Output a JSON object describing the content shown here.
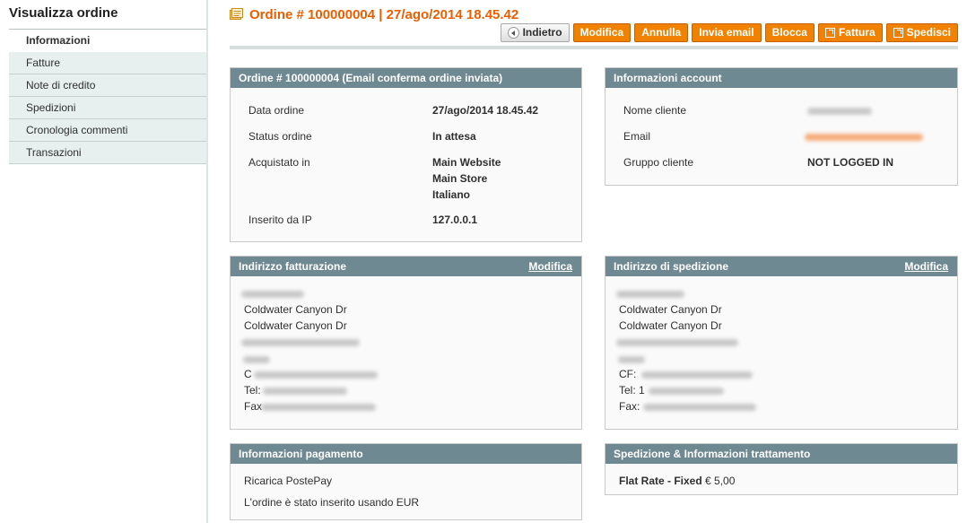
{
  "sidebar": {
    "title": "Visualizza ordine",
    "items": [
      {
        "label": "Informazioni",
        "active": true
      },
      {
        "label": "Fatture",
        "active": false
      },
      {
        "label": "Note di credito",
        "active": false
      },
      {
        "label": "Spedizioni",
        "active": false
      },
      {
        "label": "Cronologia commenti",
        "active": false
      },
      {
        "label": "Transazioni",
        "active": false
      }
    ]
  },
  "header": {
    "icon": "order-document-icon",
    "title": "Ordine # 100000004 | 27/ago/2014 18.45.42",
    "buttons": {
      "back": "Indietro",
      "edit": "Modifica",
      "cancel": "Annulla",
      "send_email": "Invia email",
      "hold": "Blocca",
      "invoice": "Fattura",
      "ship": "Spedisci"
    }
  },
  "order_info": {
    "heading": "Ordine # 100000004 (Email conferma ordine inviata)",
    "order_date_label": "Data ordine",
    "order_date": "27/ago/2014 18.45.42",
    "status_label": "Status ordine",
    "status": "In attesa",
    "purchased_from_label": "Acquistato in",
    "purchased_from": [
      "Main Website",
      "Main Store",
      "Italiano"
    ],
    "ip_label": "Inserito da IP",
    "ip": "127.0.0.1"
  },
  "account_info": {
    "heading": "Informazioni account",
    "customer_name_label": "Nome cliente",
    "email_label": "Email",
    "group_label": "Gruppo cliente",
    "group": "NOT LOGGED IN"
  },
  "billing_address": {
    "heading": "Indirizzo fatturazione",
    "edit_link": "Modifica",
    "street_1": "Coldwater Canyon Dr",
    "street_2": "Coldwater Canyon Dr",
    "cf_prefix": "C",
    "tel_prefix": "Tel:",
    "fax_prefix": "Fax"
  },
  "shipping_address": {
    "heading": "Indirizzo di spedizione",
    "edit_link": "Modifica",
    "street_1": "Coldwater Canyon Dr",
    "street_2": "Coldwater Canyon Dr",
    "cf_prefix": "CF:",
    "tel_prefix": "Tel: 1",
    "fax_prefix": "Fax:"
  },
  "payment_info": {
    "heading": "Informazioni pagamento",
    "method": "Ricarica PostePay",
    "currency_note": "L'ordine è stato inserito usando EUR"
  },
  "shipping_info": {
    "heading": "Spedizione & Informazioni trattamento",
    "method": "Flat Rate - Fixed",
    "price": "€ 5,00"
  },
  "colors": {
    "accent": "#eb5e00",
    "button": "#f18200",
    "box_header": "#6f8992",
    "sidebar_bg": "#e7efef"
  }
}
